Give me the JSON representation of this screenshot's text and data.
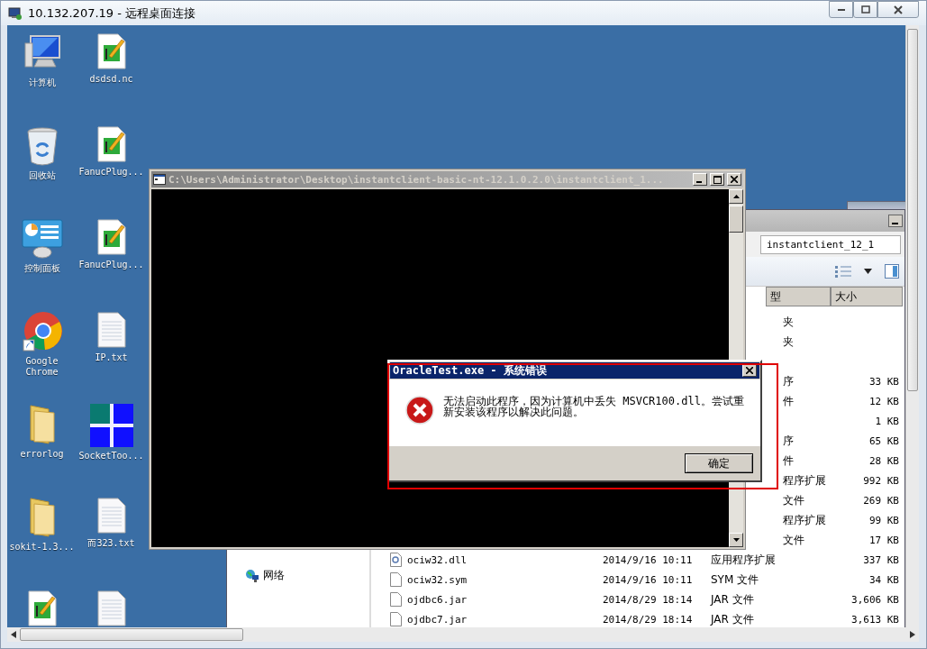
{
  "window": {
    "title": "10.132.207.19 - 远程桌面连接"
  },
  "desktop": {
    "icons": [
      {
        "kind": "computer",
        "label": "计算机"
      },
      {
        "kind": "chart-doc",
        "label": "dsdsd.nc"
      },
      {
        "kind": "recycle-bin",
        "label": "回收站"
      },
      {
        "kind": "chart-doc",
        "label": "FanucPlug..."
      },
      {
        "kind": "control-panel",
        "label": "控制面板"
      },
      {
        "kind": "chart-doc",
        "label": "FanucPlug..."
      },
      {
        "kind": "browser",
        "label": "Google Chrome"
      },
      {
        "kind": "text-doc",
        "label": "IP.txt"
      },
      {
        "kind": "folder",
        "label": "errorlog"
      },
      {
        "kind": "tiles",
        "label": "SocketToo..."
      },
      {
        "kind": "folder",
        "label": "sokit-1.3..."
      },
      {
        "kind": "text-doc",
        "label": "而323.txt"
      },
      {
        "kind": "chart-doc"
      },
      {
        "kind": "text-doc"
      }
    ]
  },
  "console": {
    "title": "C:\\Users\\Administrator\\Desktop\\instantclient-basic-nt-12.1.0.2.0\\instantclient_1..."
  },
  "explorer": {
    "address": "instantclient_12_1",
    "columns": [
      "型",
      "大小"
    ],
    "nav": [
      {
        "label": "网络"
      }
    ],
    "rows": [
      {
        "type": "夹"
      },
      {
        "type": "夹"
      },
      {},
      {
        "type": "序",
        "size": "33 KB"
      },
      {
        "type": "件",
        "size": "12 KB"
      },
      {
        "size": "1 KB"
      },
      {
        "type": "序",
        "size": "65 KB"
      },
      {
        "type": "件",
        "size": "28 KB"
      },
      {
        "type": "程序扩展",
        "size": "992 KB"
      },
      {
        "type": "文件",
        "size": "269 KB"
      },
      {
        "type": "程序扩展",
        "size": "99 KB"
      },
      {
        "type": "文件",
        "size": "17 KB"
      },
      {
        "kind": "dll",
        "name": "ociw32.dll",
        "date": "2014/9/16 10:11",
        "type": "应用程序扩展",
        "size": "337 KB"
      },
      {
        "kind": "file",
        "name": "ociw32.sym",
        "date": "2014/9/16 10:11",
        "type": "SYM 文件",
        "size": "34 KB"
      },
      {
        "kind": "file",
        "name": "ojdbc6.jar",
        "date": "2014/8/29 18:14",
        "type": "JAR 文件",
        "size": "3,606 KB"
      },
      {
        "kind": "file",
        "name": "ojdbc7.jar",
        "date": "2014/8/29 18:14",
        "type": "JAR 文件",
        "size": "3,613 KB"
      }
    ]
  },
  "dialog": {
    "title": "OracleTest.exe - 系统错误",
    "message": "无法启动此程序，因为计算机中丢失 MSVCR100.dll。尝试重新安装该程序以解决此问题。",
    "buttons": [
      "确定"
    ]
  }
}
